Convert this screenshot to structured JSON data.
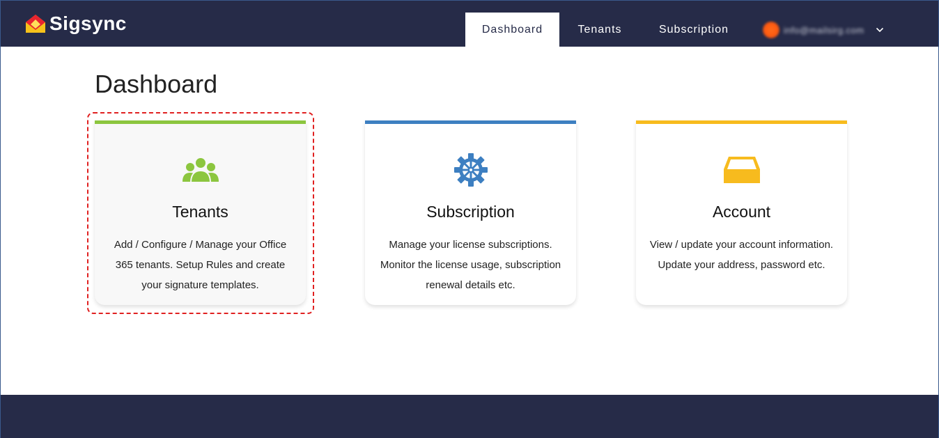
{
  "brand": {
    "name": "Sigsync"
  },
  "nav": {
    "items": [
      {
        "label": "Dashboard",
        "active": true
      },
      {
        "label": "Tenants",
        "active": false
      },
      {
        "label": "Subscription",
        "active": false
      }
    ],
    "user_email": "info@mailsirg.com"
  },
  "page": {
    "title": "Dashboard"
  },
  "cards": [
    {
      "title": "Tenants",
      "desc": "Add / Configure / Manage your Office 365 tenants. Setup Rules and create your signature templates.",
      "accent": "#8cc63f",
      "icon": "users-icon"
    },
    {
      "title": "Subscription",
      "desc": "Manage your license subscriptions. Monitor the license usage, subscription renewal details etc.",
      "accent": "#3d7fc1",
      "icon": "gear-icon"
    },
    {
      "title": "Account",
      "desc": "View / update your account information. Update your address, password etc.",
      "accent": "#f7bb1e",
      "icon": "inbox-icon"
    }
  ],
  "colors": {
    "header": "#262b48",
    "focus": "#e02020"
  }
}
